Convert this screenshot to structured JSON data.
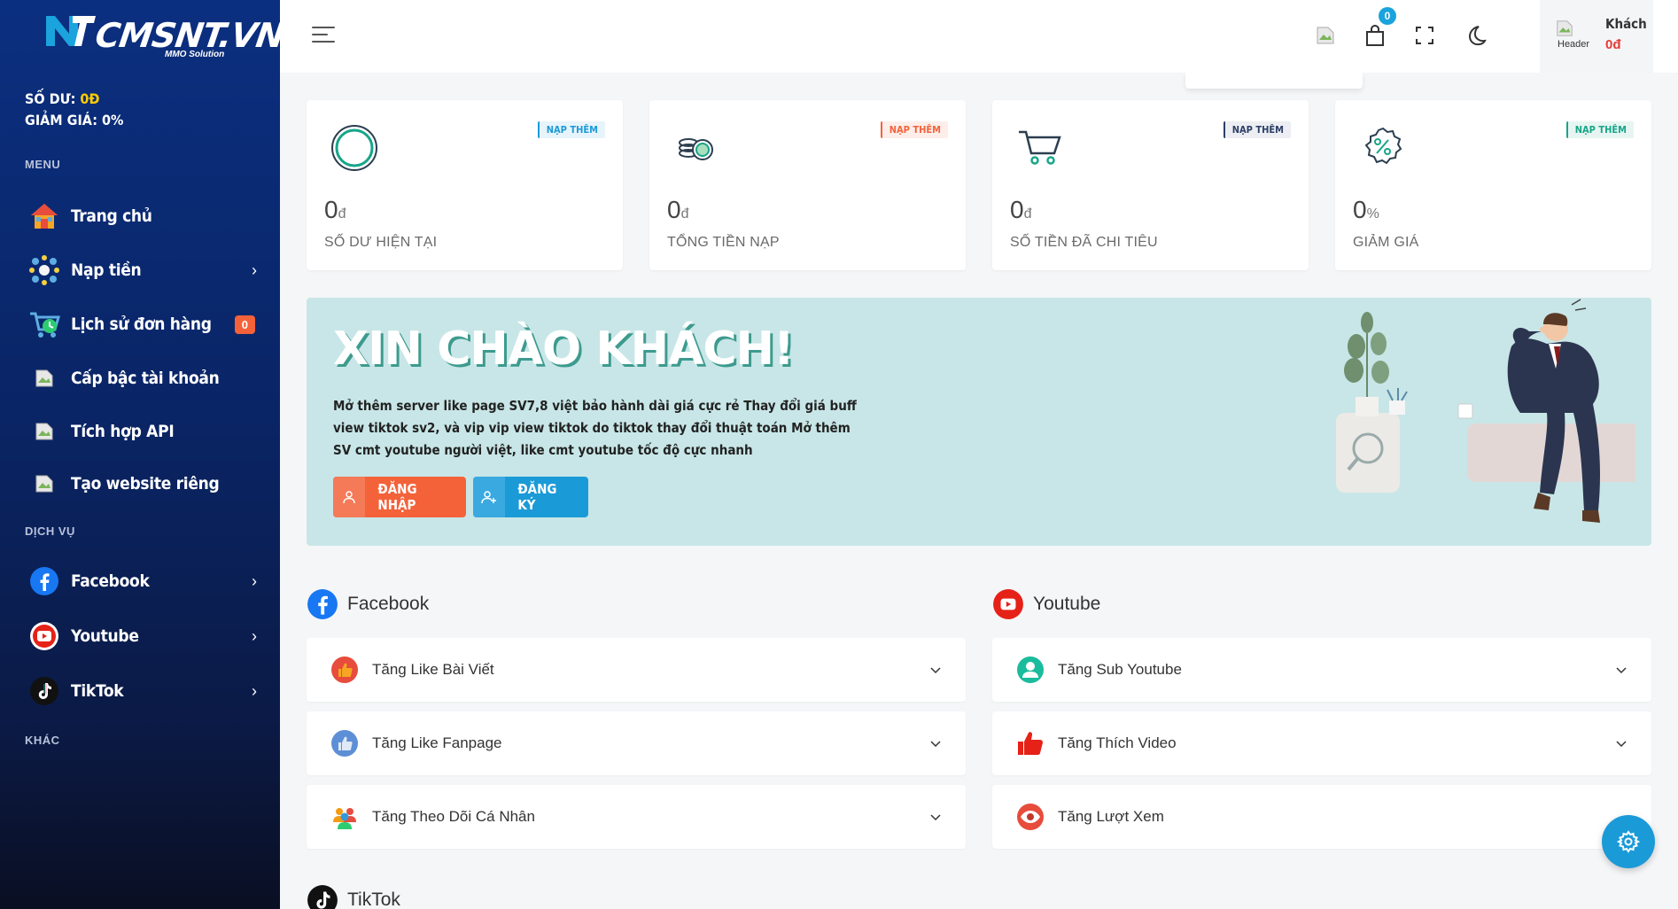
{
  "sidebar": {
    "logo_text": "CMSNT.VN",
    "logo_sub": "MMO Solution",
    "balance_label": "SỐ DƯ:",
    "balance_value": "0Đ",
    "discount_label": "GIẢM GIÁ:",
    "discount_value": "0%",
    "sections": {
      "menu": "MENU",
      "service": "DỊCH VỤ",
      "other": "KHÁC"
    },
    "menu_items": [
      {
        "label": "Trang chủ",
        "icon": "home-icon"
      },
      {
        "label": "Nạp tiền",
        "icon": "deposit-icon"
      },
      {
        "label": "Lịch sử đơn hàng",
        "icon": "cart-history-icon",
        "badge": "0"
      },
      {
        "label": "Cấp bậc tài khoản",
        "icon": "broken-image-icon"
      },
      {
        "label": "Tích hợp API",
        "icon": "broken-image-icon"
      },
      {
        "label": "Tạo website riêng",
        "icon": "broken-image-icon"
      }
    ],
    "service_items": [
      {
        "label": "Facebook",
        "icon": "facebook-icon"
      },
      {
        "label": "Youtube",
        "icon": "youtube-icon"
      },
      {
        "label": "TikTok",
        "icon": "tiktok-icon"
      }
    ]
  },
  "topbar": {
    "cart_count": "0",
    "user_name": "Khách",
    "user_balance": "0đ",
    "avatar_alt": "Header"
  },
  "stats": [
    {
      "value": "0",
      "unit": "đ",
      "label": "SỐ DƯ HIỆN TẠI",
      "tag": "NẠP THÊM",
      "tag_color": "#1b9ad8",
      "icon": "wallet-circle-icon"
    },
    {
      "value": "0",
      "unit": "đ",
      "label": "TỔNG TIỀN NẠP",
      "tag": "NẠP THÊM",
      "tag_color": "#f4623a",
      "icon": "coins-icon"
    },
    {
      "value": "0",
      "unit": "đ",
      "label": "SỐ TIỀN ĐÃ CHI TIÊU",
      "tag": "NẠP THÊM",
      "tag_color": "#2c3e66",
      "icon": "shopping-cart-icon"
    },
    {
      "value": "0",
      "unit": "%",
      "label": "GIẢM GIÁ",
      "tag": "NẠP THÊM",
      "tag_color": "#17a589",
      "icon": "discount-badge-icon"
    }
  ],
  "banner": {
    "title": "XIN CHÀO KHÁCH!",
    "text": "Mở thêm server like page SV7,8 việt bảo hành dài giá cực rẻ Thay đổi giá buff view tiktok sv2, và vip vip view tiktok do tiktok thay đổi thuật toán Mở thêm SV cmt youtube người việt, like cmt youtube tốc độ cực nhanh",
    "login_label": "ĐĂNG NHẬP",
    "register_label": "ĐĂNG KÝ"
  },
  "services": {
    "facebook": {
      "title": "Facebook",
      "items": [
        "Tăng Like Bài Viết",
        "Tăng Like Fanpage",
        "Tăng Theo Dõi Cá Nhân"
      ]
    },
    "youtube": {
      "title": "Youtube",
      "items": [
        "Tăng Sub Youtube",
        "Tăng Thích Video",
        "Tăng Lượt Xem"
      ]
    },
    "tiktok": {
      "title": "TikTok"
    }
  },
  "colors": {
    "accent_blue": "#1b9ad8",
    "accent_orange": "#f4623a",
    "sidebar_bg": "#0b2f80",
    "banner_bg": "#c8e6e7"
  }
}
